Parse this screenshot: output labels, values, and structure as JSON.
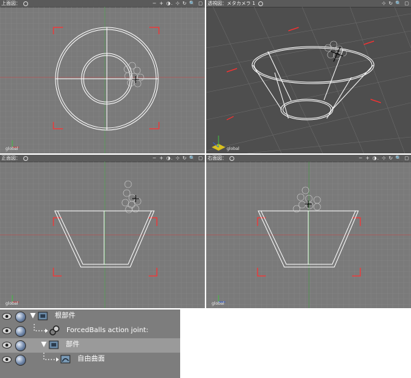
{
  "viewports": {
    "top": {
      "title": "上面図：",
      "tools": "− + ◑. ⊹ ↻ 🔍 ▢",
      "axis": "global"
    },
    "perspective": {
      "title": "透視図：メタカメラ 1",
      "tools": "⊹ ↻ 🔍 ▢",
      "axis": "global"
    },
    "front": {
      "title": "正面図：",
      "tools": "− + ◑. ⊹ ↻ 🔍 ▢",
      "axis": "global"
    },
    "right": {
      "title": "右面図：",
      "tools": "− + ◑. ⊹ ↻ 🔍 ▢",
      "axis": "global"
    }
  },
  "outliner": {
    "rows": [
      {
        "label": "根部件",
        "icon": "folder-part-icon"
      },
      {
        "label": "ForcedBalls action joint:",
        "icon": "joint-icon"
      },
      {
        "label": "部件",
        "icon": "part-icon"
      },
      {
        "label": "自由曲面",
        "icon": "free-surface-icon"
      }
    ]
  }
}
